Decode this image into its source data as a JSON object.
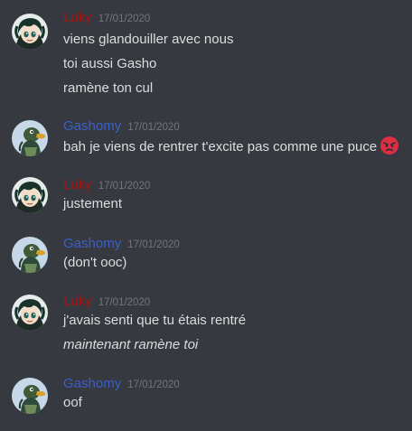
{
  "colors": {
    "background": "#36393f",
    "luky_name": "#ad1212",
    "gashomy_name": "#3a5fcd",
    "message_text": "#dcddde",
    "timestamp": "#72767d"
  },
  "messages": [
    {
      "username": "Luky",
      "timestamp": "17/01/2020",
      "avatar": "luky-avatar",
      "lines": [
        "viens glandouiller avec nous",
        "toi aussi Gasho",
        "ramène ton cul"
      ]
    },
    {
      "username": "Gashomy",
      "timestamp": "17/01/2020",
      "avatar": "gashomy-avatar",
      "lines": [
        "bah je viens de rentrer t'excite pas comme une puce"
      ],
      "emoji": "angry-face-emoji"
    },
    {
      "username": "Luky",
      "timestamp": "17/01/2020",
      "avatar": "luky-avatar",
      "lines": [
        "justement"
      ]
    },
    {
      "username": "Gashomy",
      "timestamp": "17/01/2020",
      "avatar": "gashomy-avatar",
      "lines": [
        "(don't ooc)"
      ]
    },
    {
      "username": "Luky",
      "timestamp": "17/01/2020",
      "avatar": "luky-avatar",
      "lines": [
        "j'avais senti que tu étais rentré",
        "maintenant ramène toi"
      ]
    },
    {
      "username": "Gashomy",
      "timestamp": "17/01/2020",
      "avatar": "gashomy-avatar",
      "lines": [
        "oof"
      ]
    }
  ]
}
